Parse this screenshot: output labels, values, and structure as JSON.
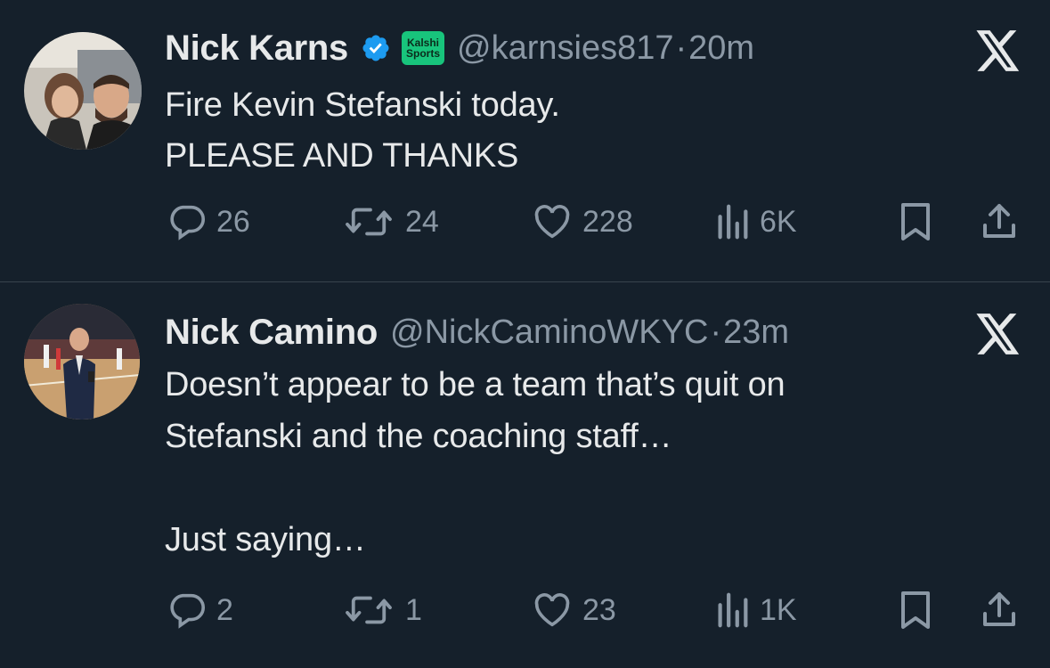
{
  "tweets": [
    {
      "name": "Nick Karns",
      "verified": true,
      "affiliate_badge": "Kalshi Sports",
      "badge_line1": "Kalshi",
      "badge_line2": "Sports",
      "handle": "@karnsies817",
      "separator": "·",
      "time": "20m",
      "text": "Fire Kevin Stefanski today.\nPLEASE AND THANKS",
      "replies": "26",
      "retweets": "24",
      "likes": "228",
      "views": "6K"
    },
    {
      "name": "Nick Camino",
      "verified": false,
      "handle": "@NickCaminoWKYC",
      "separator": "·",
      "time": "23m",
      "text": "Doesn’t appear to be a team that’s quit on\nStefanski and the coaching staff…\n\nJust saying…",
      "replies": "2",
      "retweets": "1",
      "likes": "23",
      "views": "1K"
    }
  ],
  "icons": [
    "x-logo-icon",
    "verified-badge-icon",
    "reply-icon",
    "retweet-icon",
    "like-icon",
    "views-icon",
    "bookmark-icon",
    "share-icon"
  ],
  "colors": {
    "background": "#15202b",
    "text": "#e7e9ea",
    "secondary": "#8b98a5",
    "verified": "#1d9bf0",
    "kalshi": "#18c47c",
    "divider": "#38444d"
  }
}
